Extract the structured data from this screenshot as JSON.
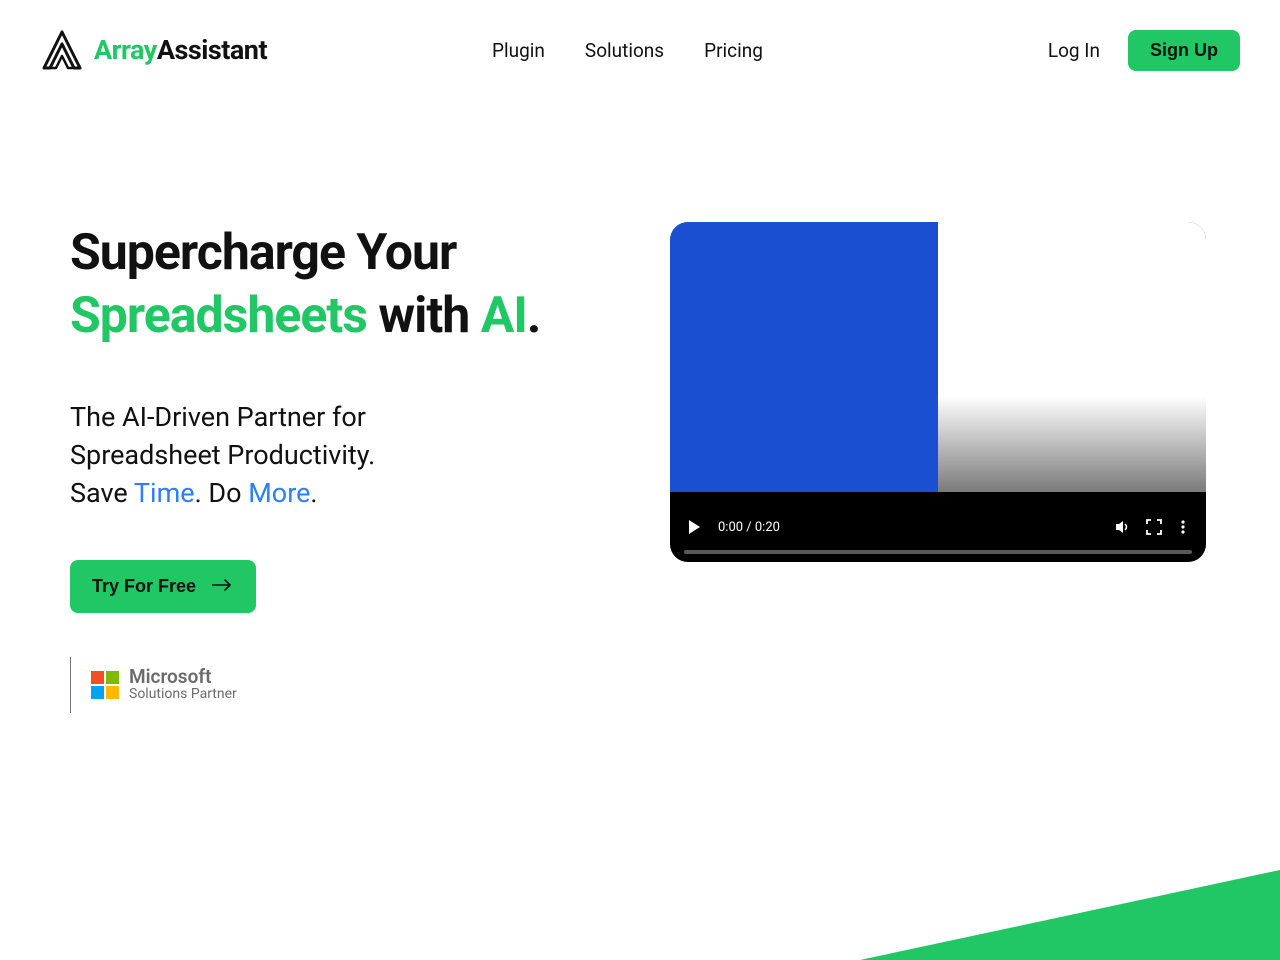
{
  "header": {
    "brand_first": "Array",
    "brand_second": "Assistant",
    "nav": [
      "Plugin",
      "Solutions",
      "Pricing"
    ],
    "login": "Log In",
    "signup": "Sign Up"
  },
  "hero": {
    "headline_1": "Supercharge Your",
    "headline_2a": "Spreadsheets",
    "headline_2b": " with ",
    "headline_2c": "AI",
    "headline_2d": ".",
    "sub_1": "The AI-Driven Partner for Spreadsheet Productivity.",
    "sub_2a": "Save ",
    "sub_2b": "Time",
    "sub_2c": ". Do ",
    "sub_2d": "More",
    "sub_2e": ".",
    "cta": "Try For Free",
    "partner_line1": "Microsoft",
    "partner_line2": "Solutions Partner"
  },
  "video": {
    "time": "0:00 / 0:20"
  }
}
